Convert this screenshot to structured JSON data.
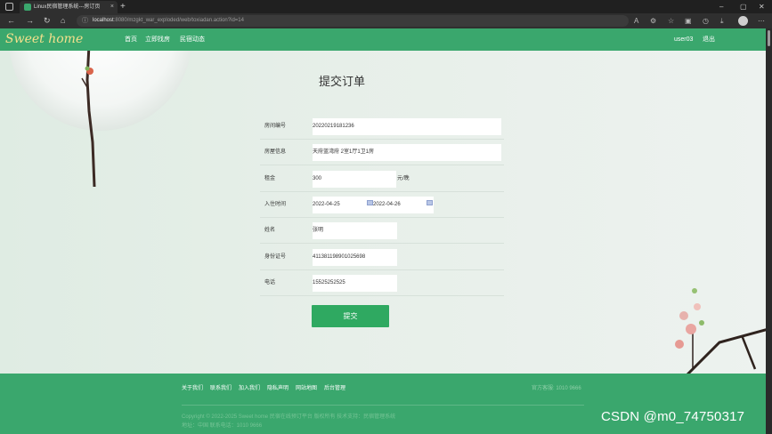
{
  "browser": {
    "tab_title": "Linux民宿管理系统---房订页",
    "tab_close": "×",
    "new_tab": "+",
    "url_host": "localhost",
    "url_rest": ":8080/mzgkt_war_exploded/web/toxiadan.action?id=14",
    "controls": [
      "–",
      "▢",
      "✕"
    ]
  },
  "site": {
    "logo": "Sweet home",
    "nav": [
      "首页",
      "立即找房",
      "民宿动态"
    ],
    "user": "user03",
    "logout": "退出"
  },
  "form": {
    "title": "提交订单",
    "fields": [
      {
        "label": "房间编号",
        "value": "20220219181236"
      },
      {
        "label": "房屋信息",
        "value": "天府蓝湾府 2室1厅1卫1房"
      },
      {
        "label": "租金",
        "value": "300",
        "unit": "元/晚"
      },
      {
        "label": "入住时间",
        "start": "2022-04-25",
        "end": "2022-04-26"
      },
      {
        "label": "姓名",
        "value": "张明"
      },
      {
        "label": "身份证号",
        "value": "411381198901025698"
      },
      {
        "label": "电话",
        "value": "15525252525"
      }
    ],
    "submit": "提交"
  },
  "footer": {
    "links": [
      "关于我们",
      "联系我们",
      "加入我们",
      "隐私声明",
      "网站地图",
      "后台管理"
    ],
    "official": "官方客服: 1010 9666",
    "copyright_line1": "Copyright © 2022-2025 Sweet home 民宿在线预订平台 版权所有 技术支持：民宿管理系统",
    "copyright_line2": "地址：中国 联系电话：1010 9666"
  },
  "watermark": "CSDN @m0_74750317",
  "colors": {
    "brand_green": "#3aa76d",
    "button_green": "#2fa961",
    "logo_gold": "#f4e08c"
  }
}
